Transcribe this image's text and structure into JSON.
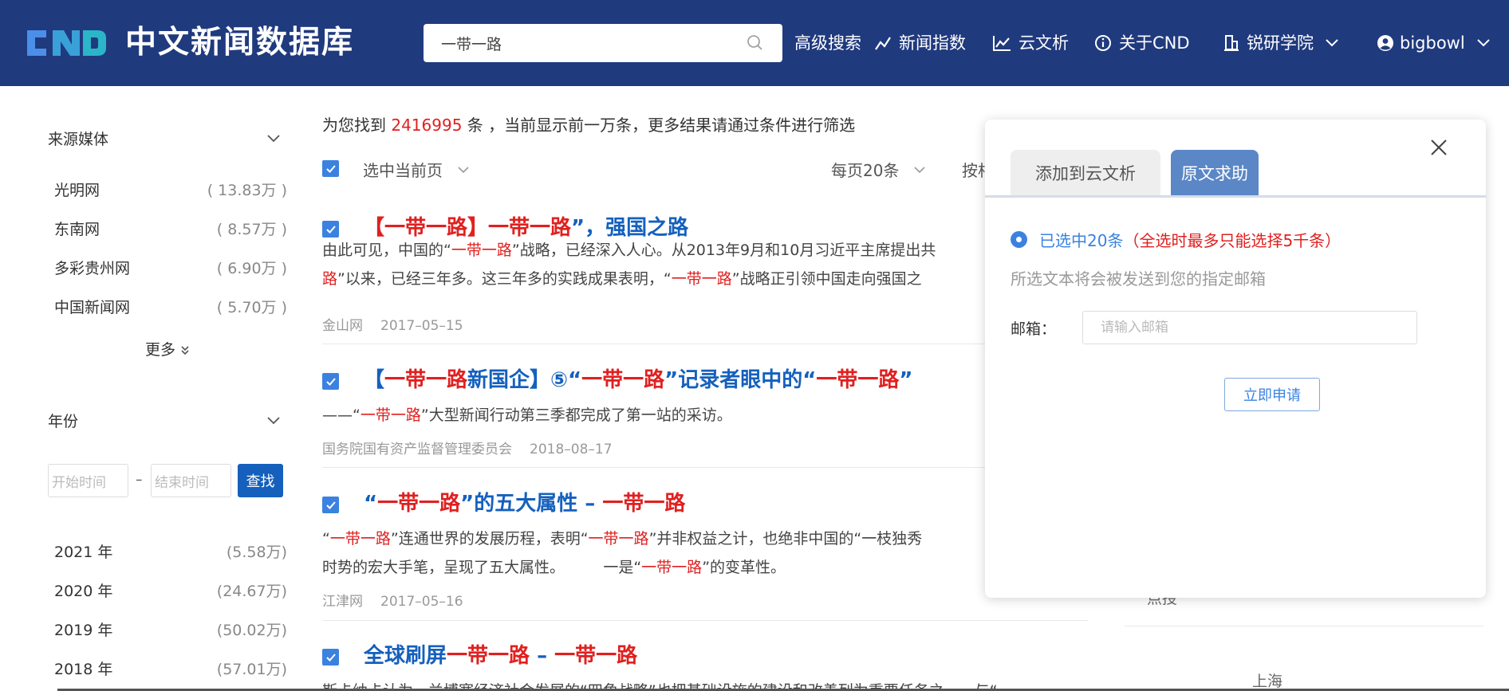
{
  "header": {
    "logo_text": "CND",
    "title": "中文新闻数据库",
    "search": {
      "value": "一带一路",
      "placeholder": ""
    },
    "nav": {
      "advanced_search": "高级搜索",
      "news_index": "新闻指数",
      "cloud_analysis": "云文析",
      "about": "关于CND",
      "academy": "锐研学院",
      "user": "bigbowl"
    },
    "colors": {
      "bar": "#203a7e",
      "logo_blue": "#4a8fe8",
      "logo_teal": "#2bb5c9"
    }
  },
  "sidebar": {
    "source_title": "来源媒体",
    "sources": [
      {
        "name": "光明网",
        "count": "( 13.83万 )"
      },
      {
        "name": "东南网",
        "count": "( 8.57万 )"
      },
      {
        "name": "多彩贵州网",
        "count": "( 6.90万 )"
      },
      {
        "name": "中国新闻网",
        "count": "( 5.70万 )"
      }
    ],
    "more": "更多",
    "year_title": "年份",
    "start_placeholder": "开始时间",
    "dash": "–",
    "end_placeholder": "结束时间",
    "find_button": "查找",
    "years": [
      {
        "name": "2021 年",
        "count": "(5.58万)"
      },
      {
        "name": "2020 年",
        "count": "(24.67万)"
      },
      {
        "name": "2019 年",
        "count": "(50.02万)"
      },
      {
        "name": "2018 年",
        "count": "(57.01万)"
      }
    ]
  },
  "results": {
    "summary_prefix": "为您找到 ",
    "summary_count": "2416995",
    "summary_suffix": " 条 ，当前显示前一万条，更多结果请通过条件进行筛选",
    "select_page": "选中当前页",
    "per_page": "每页20条",
    "sort_partial": "按相",
    "articles": [
      {
        "title_parts": [
          "【一带一路】一带一路",
          "”，强国之路"
        ],
        "text_line1_parts": [
          "由此可见，中国的“",
          "一带一路",
          "”战略，已经深入人心。从2013年9月和10月习近平主席提出共"
        ],
        "text_line2_parts": [
          "路",
          "”以来，已经三年多。这三年多的实践成果表明，“",
          "一带一路",
          "”战略正引领中国走向强国之"
        ],
        "source": "金山网",
        "date": "2017–05–15"
      },
      {
        "title_parts": [
          "【",
          "一带一路",
          "新国企】⑤“",
          "一带一路",
          "”记录者眼中的“",
          "一带一路",
          "”"
        ],
        "text_line1_parts": [
          "——“",
          "一带一路",
          "”大型新闻行动第三季都完成了第一站的采访。"
        ],
        "source": "国务院国有资产监督管理委员会",
        "date": "2018–08–17"
      },
      {
        "title_parts": [
          "“",
          "一带一路",
          "”的五大属性 – ",
          "一带一路"
        ],
        "text_line1_parts": [
          "“",
          "一带一路",
          "”连通世界的发展历程，表明“",
          "一带一路",
          "”并非权益之计，也绝非中国的“一枝独秀"
        ],
        "text_line2_parts": [
          "时势的宏大手笔，呈现了五大属性。        一是“",
          "一带一路",
          "”的变革性。"
        ],
        "source": "江津网",
        "date": "2017–05–16"
      },
      {
        "title_parts": [
          "全球刷屏",
          "一带一路",
          " – ",
          "一带一路"
        ],
        "text_line1_parts": [
          "斯卡纳卡认为，兰博塞经济社会发展的“四角战略”也把基础设施的建设和改善列为重要任务之一，与“"
        ]
      }
    ]
  },
  "dialog": {
    "tab_analysis": "添加到云文析",
    "tab_request": "原文求助",
    "selected_a": "已选中20条",
    "selected_b": "（全选时最多只能选择5千条）",
    "hint": "所选文本将会被发送到您的指定邮箱",
    "email_label": "邮箱：",
    "email_placeholder": "请输入邮箱",
    "apply_button": "立即申请"
  },
  "peek": {
    "text1": "点授",
    "text2": "上海"
  }
}
